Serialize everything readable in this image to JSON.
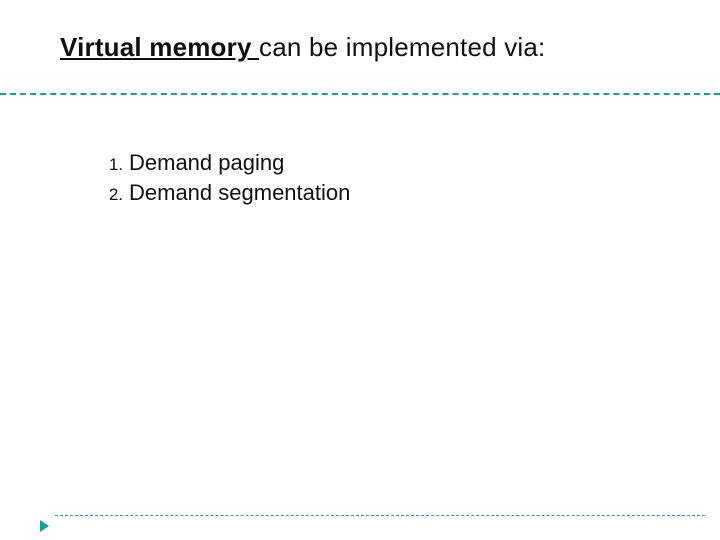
{
  "title": {
    "underlined": "Virtual memory ",
    "rest": "can be implemented via:"
  },
  "list": {
    "items": [
      {
        "num": "1.",
        "text": "Demand paging"
      },
      {
        "num": "2.",
        "text": "Demand segmentation"
      }
    ]
  }
}
